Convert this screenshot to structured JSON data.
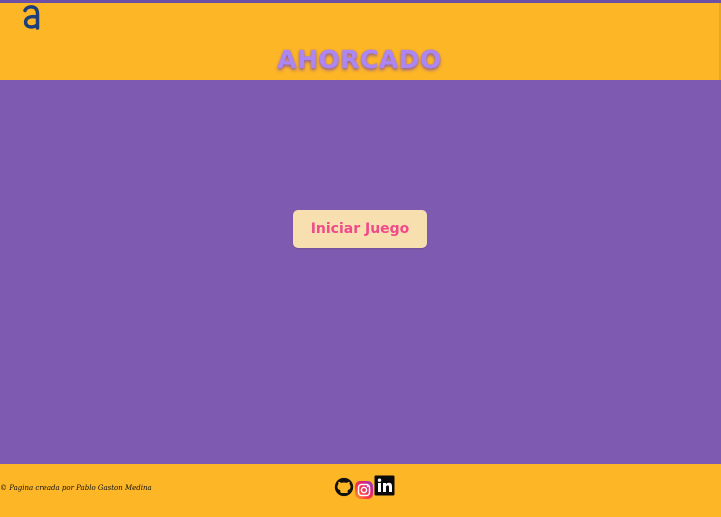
{
  "header": {
    "logo_icon": "alura-logo-icon",
    "title": "AHORCADO"
  },
  "main": {
    "start_button_label": "Iniciar Juego"
  },
  "footer": {
    "credits": "© Pagina creada por Pablo Gaston Medina",
    "social": [
      {
        "icon": "github-icon"
      },
      {
        "icon": "instagram-icon"
      },
      {
        "icon": "linkedin-icon"
      }
    ]
  },
  "colors": {
    "header_background": "#fdb626",
    "page_background": "#7e5ab1",
    "title": "#ac87f4",
    "button_background": "#f8dfb0",
    "button_text": "#ef4b8a",
    "logo": "#1c3f7c"
  }
}
